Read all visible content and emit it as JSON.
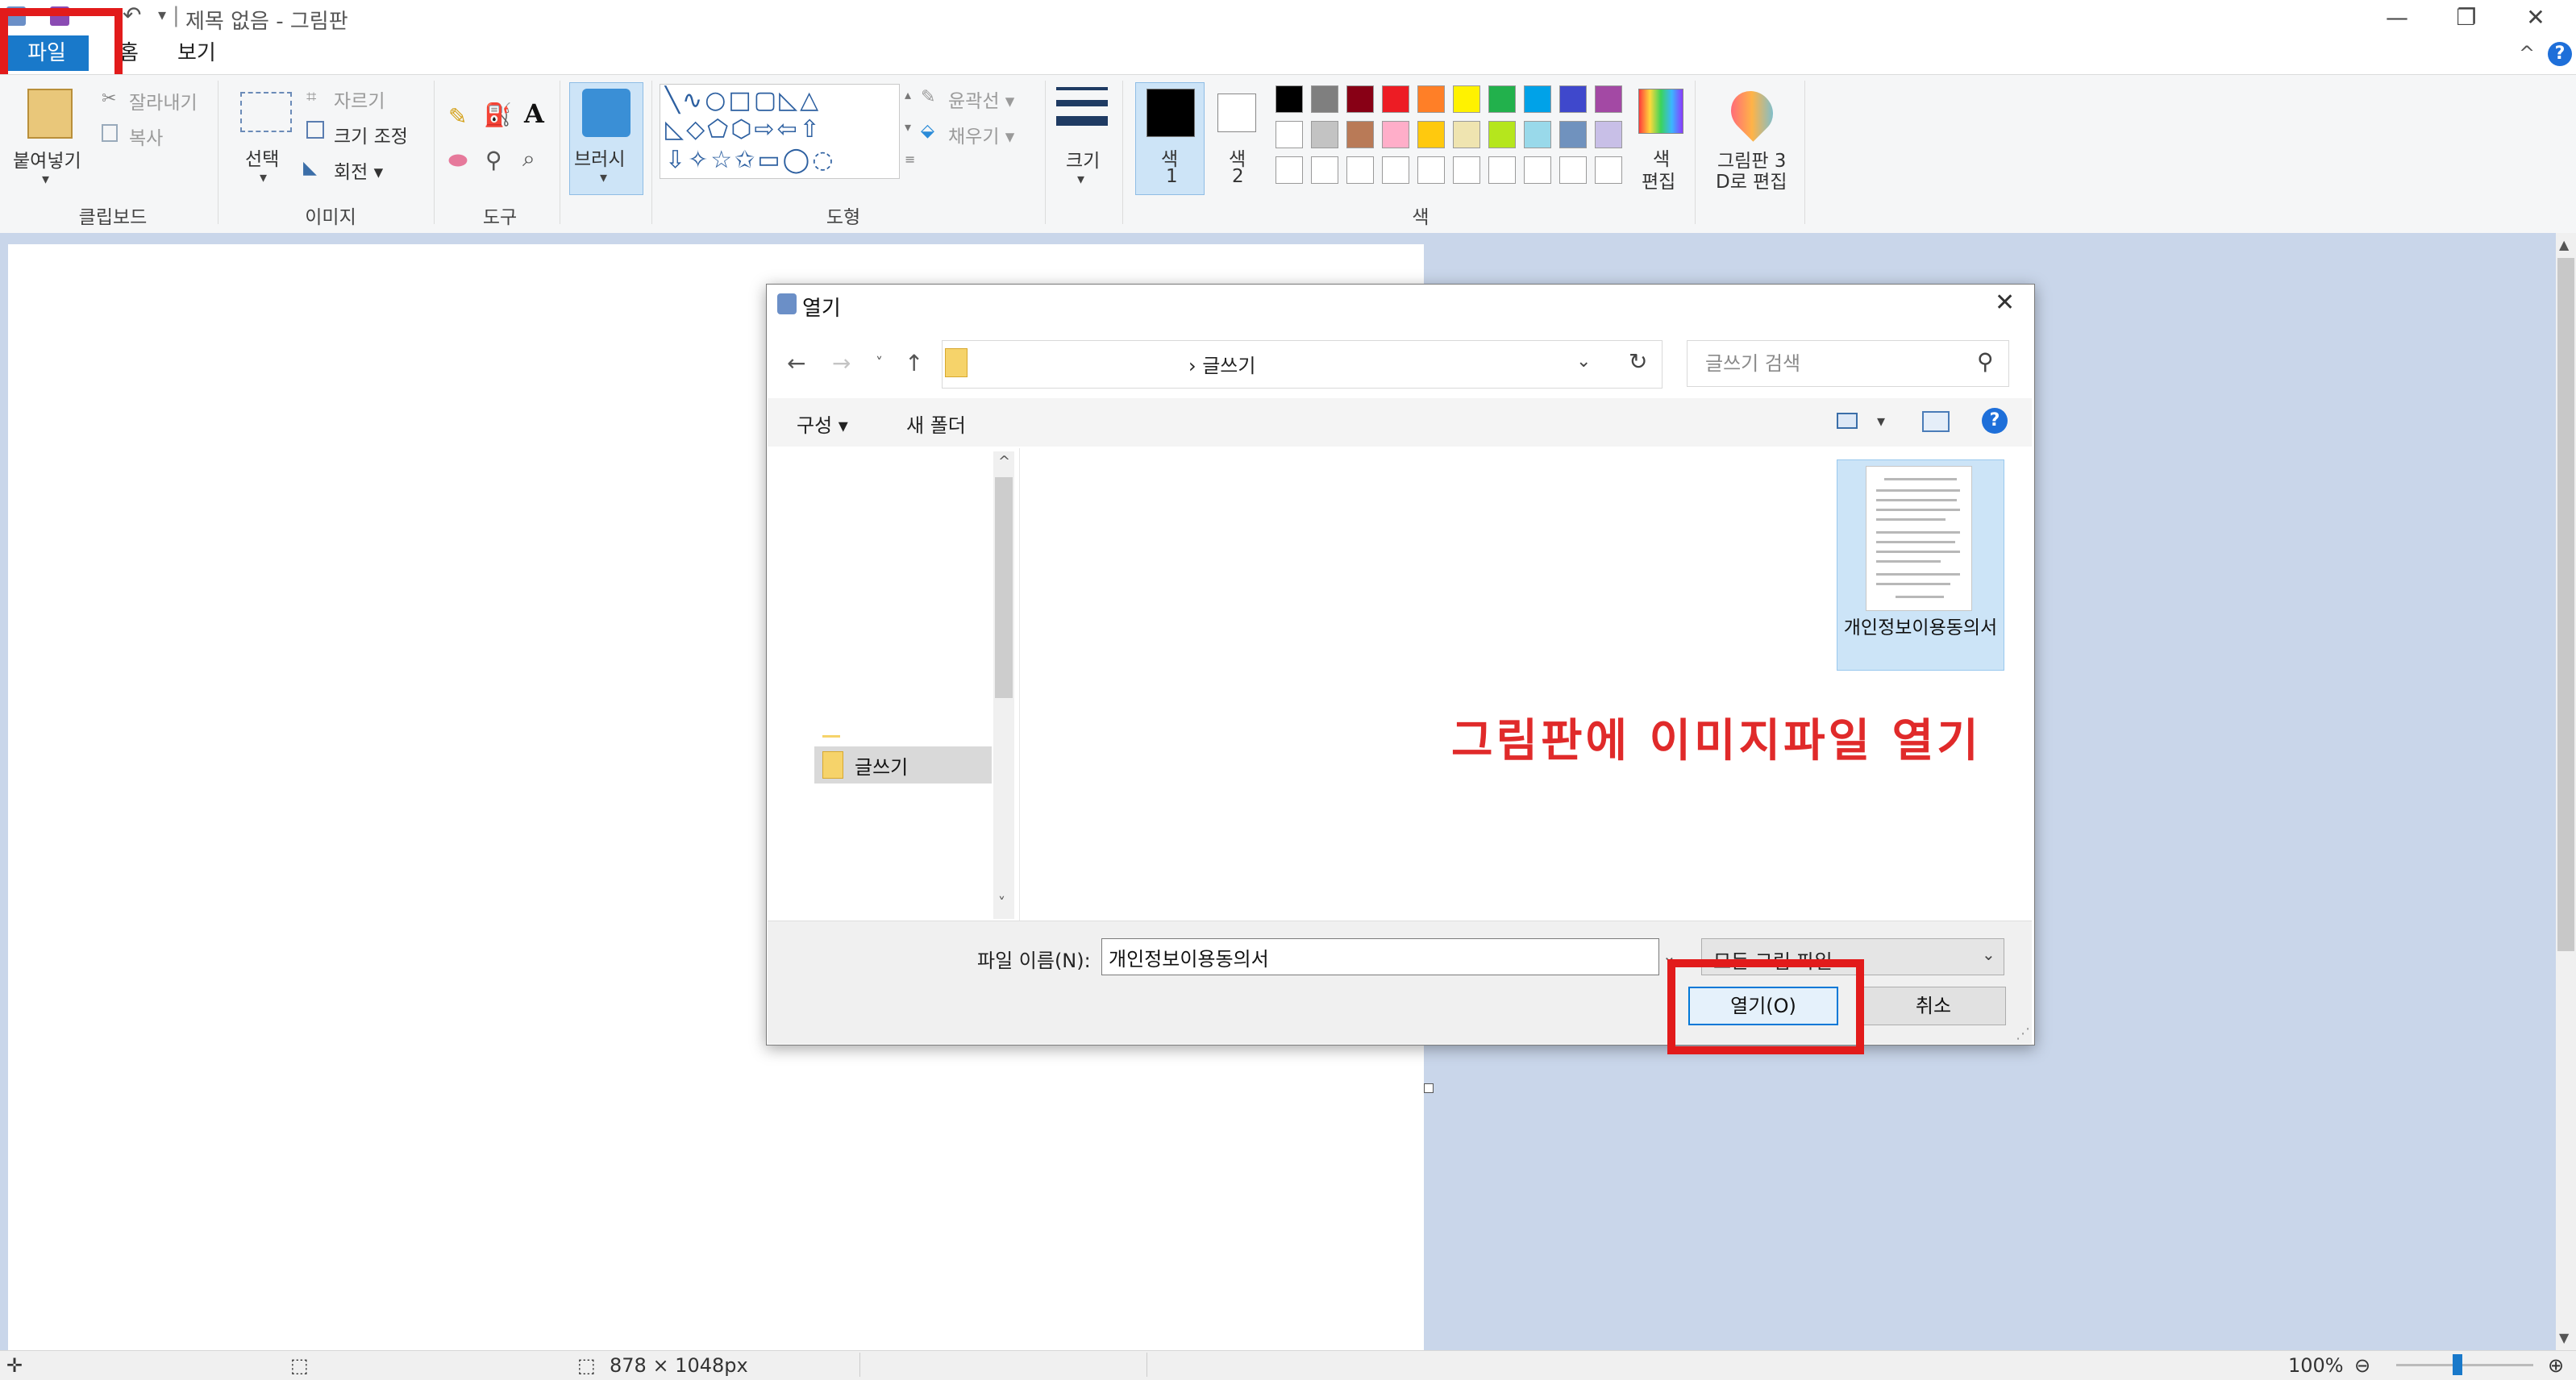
{
  "app": {
    "title": "제목 없음 - 그림판",
    "qat_divider": "|",
    "window_buttons": {
      "minimize": "—",
      "restore": "❐",
      "close": "✕"
    }
  },
  "tabs": {
    "file": "파일",
    "home": "홈",
    "view": "보기"
  },
  "ribbon": {
    "clipboard": {
      "paste": "붙여넣기",
      "cut": "잘라내기",
      "copy": "복사",
      "label": "클립보드"
    },
    "image": {
      "select": "선택",
      "crop": "자르기",
      "resize": "크기 조정",
      "rotate": "회전 ▾",
      "label": "이미지"
    },
    "tools": {
      "label": "도구"
    },
    "brush": {
      "label": "브러시"
    },
    "shapes": {
      "outline": "윤곽선 ▾",
      "fill": "채우기 ▾",
      "label": "도형"
    },
    "size": {
      "label": "크기"
    },
    "colors": {
      "color1_a": "색",
      "color1_b": "1",
      "color2_a": "색",
      "color2_b": "2",
      "edit_a": "색",
      "edit_b": "편집",
      "label": "색",
      "row1": [
        "#000000",
        "#7f7f7f",
        "#880015",
        "#ed1c24",
        "#ff7f27",
        "#fff200",
        "#22b14c",
        "#00a2e8",
        "#3f48cc",
        "#a349a4"
      ],
      "row2": [
        "#ffffff",
        "#c3c3c3",
        "#b97a57",
        "#ffaec9",
        "#ffc90e",
        "#efe4b0",
        "#b5e61d",
        "#99d9ea",
        "#7092be",
        "#c8bfe7"
      ]
    },
    "paint3d": {
      "line1": "그림판 3",
      "line2": "D로 편집"
    }
  },
  "status": {
    "size": "878 × 1048px",
    "zoom": "100%"
  },
  "dialog": {
    "title": "열기",
    "address_path": "› 글쓰기",
    "search_placeholder": "글쓰기 검색",
    "organize": "구성 ▾",
    "new_folder": "새 폴더",
    "nav_selected": "글쓰기",
    "file_name_display": "개인정보이용동의서",
    "file_name_label": "파일 이름(N):",
    "file_name_value": "개인정보이용동의서",
    "file_type": "모든 그림 파일",
    "open_button": "열기(O)",
    "cancel_button": "취소"
  },
  "annotation": {
    "caption": "그림판에 이미지파일 열기",
    "highlight_color": "#e21b1b"
  }
}
